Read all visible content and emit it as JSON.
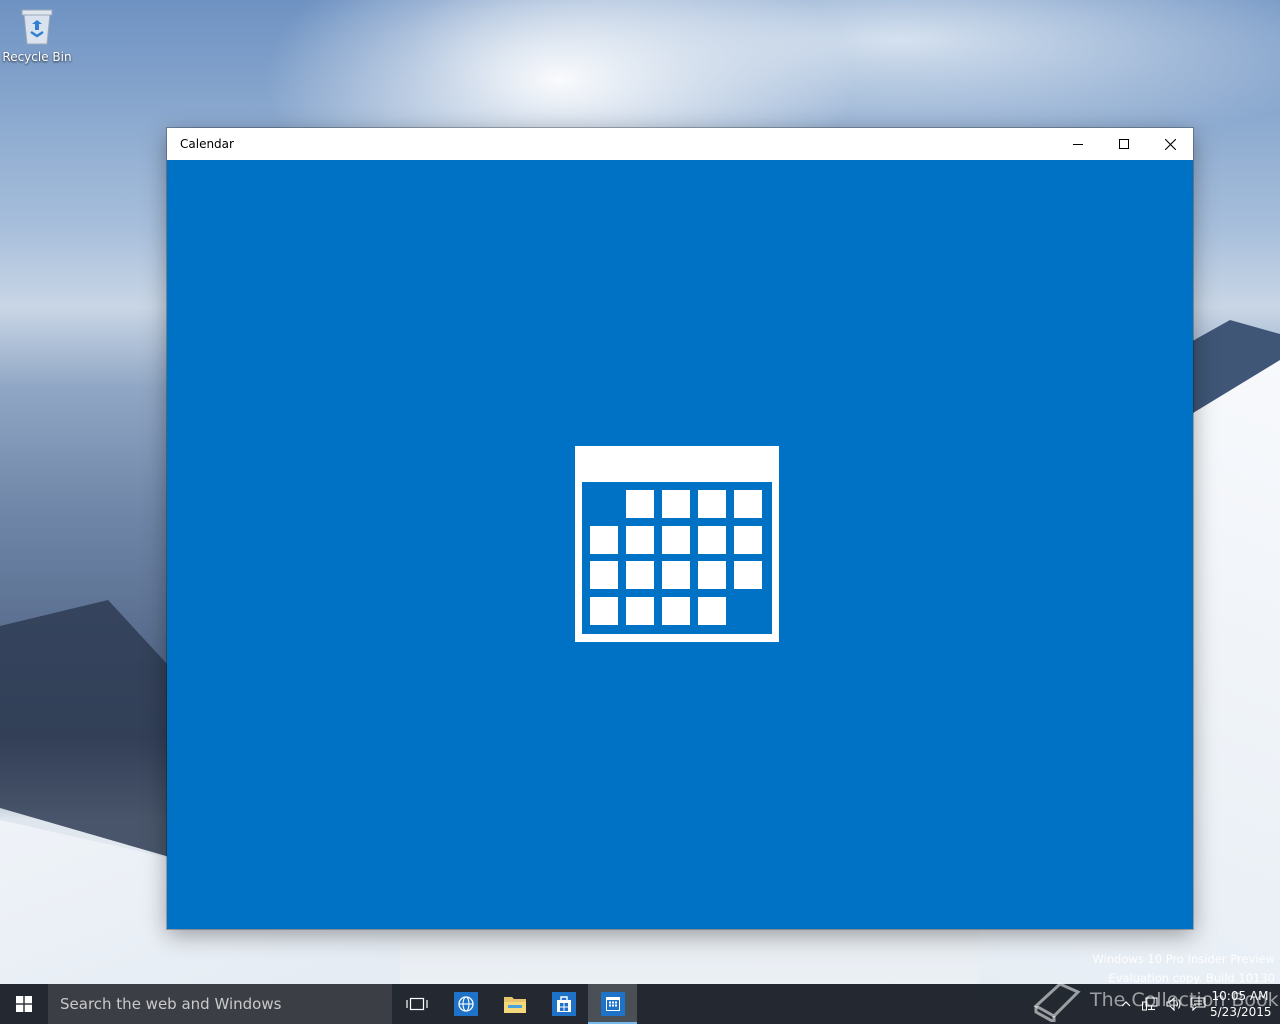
{
  "desktop": {
    "recycle_bin_label": "Recycle Bin"
  },
  "window": {
    "title": "Calendar",
    "caption_buttons": [
      "minimize-icon",
      "maximize-icon",
      "close-icon"
    ],
    "background_color": "#0072c6",
    "splash_icon": "calendar-icon"
  },
  "watermark": {
    "line1": "Windows 10 Pro Insider Preview",
    "line2": "Evaluation copy. Build 10130",
    "brand": "The Collection Book"
  },
  "taskbar": {
    "search_placeholder": "Search the web and Windows",
    "pinned": [
      "task-view-icon",
      "edge-icon",
      "file-explorer-icon",
      "store-icon",
      "calendar-icon"
    ],
    "active_app": "calendar-icon",
    "tray_icons": [
      "chevron-up-icon",
      "network-icon",
      "volume-icon",
      "action-center-icon"
    ],
    "time": "10:05 AM",
    "date": "5/23/2015"
  }
}
